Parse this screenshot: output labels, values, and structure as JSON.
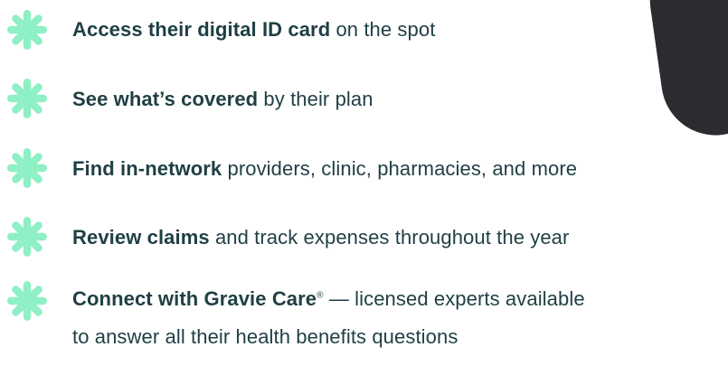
{
  "colors": {
    "accent": "#8EF0C4",
    "text": "#1F3F44",
    "device": "#2A2C2F"
  },
  "icon_name": "sparkle-star-icon",
  "benefits": [
    {
      "bold": "Access their digital ID card",
      "rest": " on the spot"
    },
    {
      "bold": "See what’s covered",
      "rest": " by their plan"
    },
    {
      "bold": "Find in-network",
      "rest": " providers, clinic, pharmacies, and more"
    },
    {
      "bold": "Review claims",
      "rest": " and track expenses throughout the year"
    },
    {
      "bold": "Connect with Gravie Care",
      "superscript": "®",
      "rest": " — licensed experts available",
      "line2": "to answer all their health benefits questions"
    }
  ]
}
